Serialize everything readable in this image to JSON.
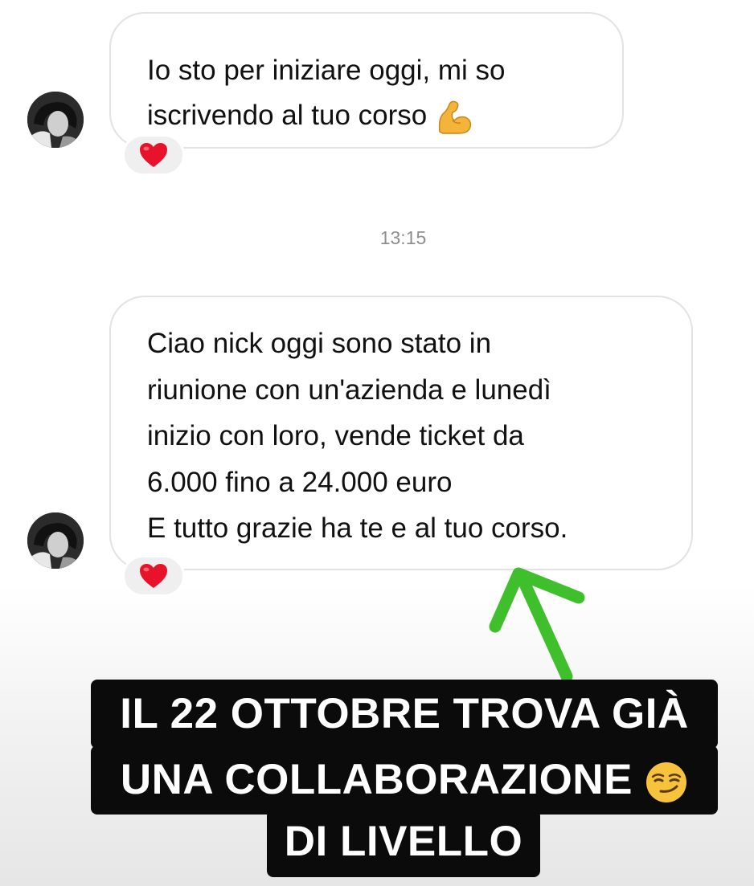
{
  "messages": [
    {
      "lines": [
        "Io sto per iniziare oggi, mi so",
        "iscrivendo al tuo corso"
      ],
      "trailing_emoji": "flexed-biceps-emoji",
      "reaction": "red-heart-emoji"
    },
    {
      "lines": [
        "Ciao nick oggi sono stato in",
        "riunione con un'azienda e lunedì",
        "inizio con loro, vende ticket da",
        "6.000 fino a 24.000 euro",
        "E tutto grazie ha te e al tuo corso."
      ],
      "reaction": "red-heart-emoji"
    }
  ],
  "timestamp": "13:15",
  "annotation": {
    "arrow_color": "#3fbf2b",
    "arrow_icon": "arrow-up-icon"
  },
  "caption": {
    "lines": [
      "IL 22 OTTOBRE TROVA GIÀ",
      "UNA COLLABORAZIONE",
      "DI LIVELLO"
    ],
    "emoji": "smirking-face-emoji"
  },
  "colors": {
    "bubble_border": "#e2e2e2",
    "timestamp": "#8e8e8e",
    "caption_background": "#0b0b0b",
    "heart": "#e8122a"
  }
}
